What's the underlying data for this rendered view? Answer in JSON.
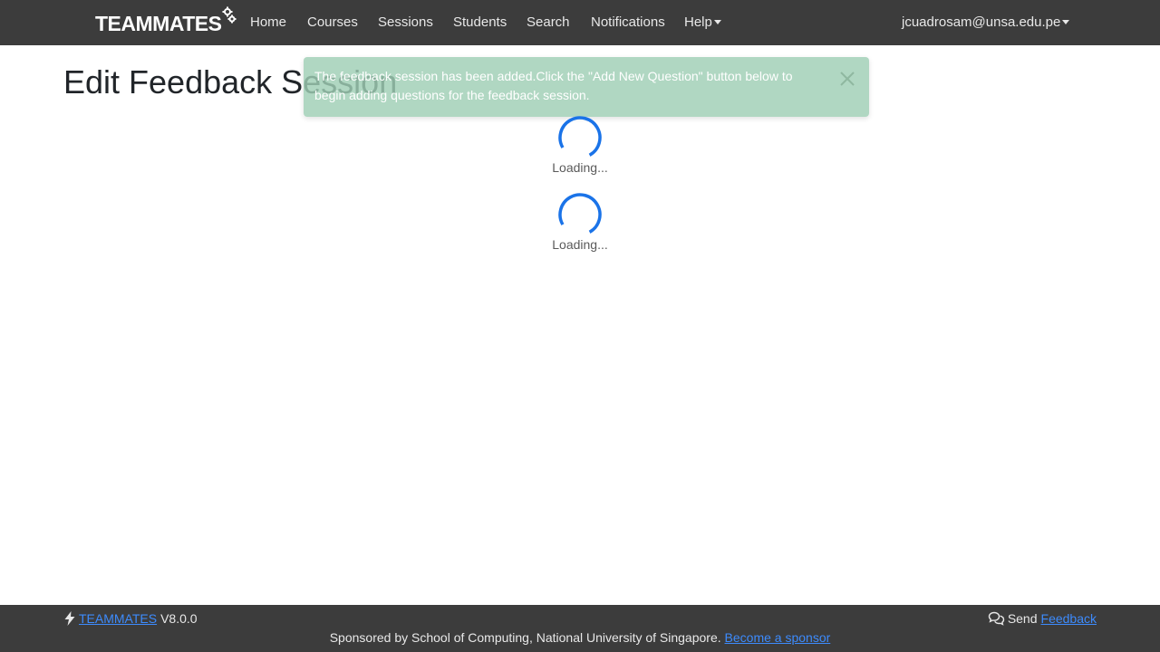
{
  "navbar": {
    "brand": "TEAMMATES",
    "links": [
      {
        "label": "Home"
      },
      {
        "label": "Courses"
      },
      {
        "label": "Sessions"
      },
      {
        "label": "Students"
      },
      {
        "label": "Search"
      },
      {
        "label": "Notifications"
      },
      {
        "label": "Help"
      }
    ],
    "user": "jcuadrosam@unsa.edu.pe"
  },
  "page": {
    "title": "Edit Feedback Session"
  },
  "toast": {
    "message": "The feedback session has been added.Click the \"Add New Question\" button below to begin adding questions for the feedback session.",
    "close_icon": "close-icon"
  },
  "loaders": [
    {
      "text": "Loading..."
    },
    {
      "text": "Loading..."
    }
  ],
  "footer": {
    "product_link": "TEAMMATES",
    "version": "V8.0.0",
    "send_label": "Send",
    "feedback_link": "Feedback",
    "sponsor_text": "Sponsored by School of Computing, National University of Singapore.",
    "sponsor_link": "Become a sponsor"
  },
  "colors": {
    "navbar_bg": "#3c3c3c",
    "toast_bg": "#9fceb4",
    "spinner": "#1a73e8",
    "link": "#3d8bfd"
  }
}
